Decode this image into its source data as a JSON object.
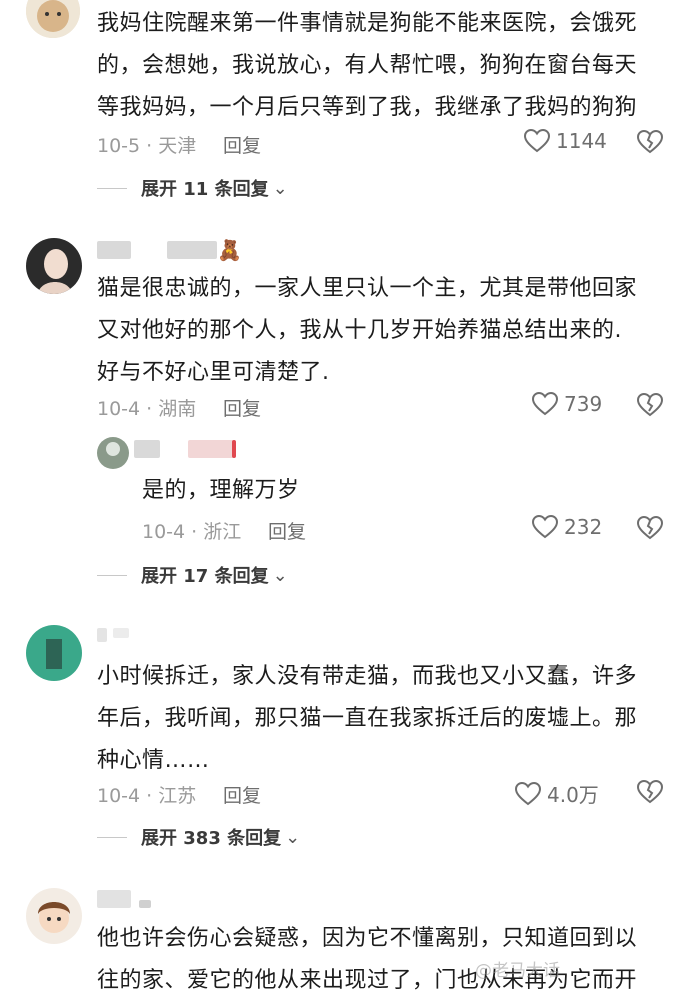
{
  "comments": [
    {
      "text": "我妈住院醒来第一件事情就是狗能不能来医院，会饿死\n的，会想她，我说放心，有人帮忙喂，狗狗在窗台每天\n等我妈妈，一个月后只等到了我，我继承了我妈的狗狗",
      "date_location": "10-5 · 天津",
      "reply_label": "回复",
      "likes": "1144",
      "expand_label": "展开 11 条回复"
    },
    {
      "text": "猫是很忠诚的，一家人里只认一个主，尤其是带他回家\n又对他好的那个人，我从十几岁开始养猫总结出来的.\n好与不好心里可清楚了.",
      "date_location": "10-4 · 湖南",
      "reply_label": "回复",
      "likes": "739",
      "reply": {
        "text": "是的，理解万岁",
        "date_location": "10-4 · 浙江",
        "reply_label": "回复",
        "likes": "232"
      },
      "expand_label": "展开 17 条回复"
    },
    {
      "text": "小时候拆迁，家人没有带走猫，而我也又小又蠢，许多\n年后，我听闻，那只猫一直在我家拆迁后的废墟上。那\n种心情……",
      "date_location": "10-4 · 江苏",
      "reply_label": "回复",
      "likes": "4.0万",
      "expand_label": "展开 383 条回复"
    },
    {
      "text": "他也许会伤心会疑惑，因为它不懂离别，只知道回到以\n往的家、爱它的他从来出现过了，门也从未再为它而开"
    }
  ],
  "watermark": "@老马大话",
  "icons": {
    "like": "heart-outline-icon",
    "dislike": "broken-heart-icon",
    "expand": "chevron-down-icon"
  },
  "colors": {
    "text": "#1c1c1c",
    "meta": "#9a9a9a",
    "action": "#6e6e6e"
  }
}
